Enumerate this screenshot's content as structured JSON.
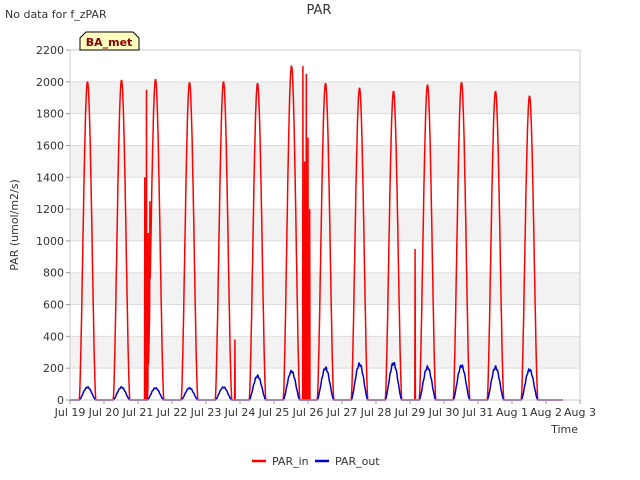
{
  "corner_note": "No data for f_zPAR",
  "chart_data": {
    "type": "line",
    "title": "PAR",
    "xlabel": "Time",
    "ylabel": "PAR (umol/m2/s)",
    "station_badge": "BA_met",
    "ylim": [
      0,
      2200
    ],
    "yticks": [
      0,
      200,
      400,
      600,
      800,
      1000,
      1200,
      1400,
      1600,
      1800,
      2000,
      2200
    ],
    "xticks": [
      "Jul 19",
      "Jul 20",
      "Jul 21",
      "Jul 22",
      "Jul 23",
      "Jul 24",
      "Jul 25",
      "Jul 26",
      "Jul 27",
      "Jul 28",
      "Jul 29",
      "Jul 30",
      "Jul 31",
      "Aug 1",
      "Aug 2",
      "Aug 3"
    ],
    "x_range_days": [
      0,
      15
    ],
    "grid": "horizontal banded",
    "legend_position": "bottom-center",
    "series": [
      {
        "name": "PAR_in",
        "color": "#ff0000",
        "daily_peaks": [
          2000,
          2010,
          2015,
          1995,
          2000,
          1990,
          2100,
          1990,
          1960,
          1940,
          1980,
          1995,
          1940,
          1910
        ],
        "spikes": [
          {
            "day": 2.2,
            "value": 1400
          },
          {
            "day": 2.25,
            "value": 1950
          },
          {
            "day": 2.3,
            "value": 1050
          },
          {
            "day": 2.35,
            "value": 1250
          },
          {
            "day": 6.85,
            "value": 2100
          },
          {
            "day": 6.9,
            "value": 1500
          },
          {
            "day": 6.95,
            "value": 2050
          },
          {
            "day": 7.0,
            "value": 1650
          },
          {
            "day": 7.05,
            "value": 1200
          },
          {
            "day": 4.85,
            "value": 380
          },
          {
            "day": 10.15,
            "value": 950
          }
        ]
      },
      {
        "name": "PAR_out",
        "color": "#0000cc",
        "daily_peaks": [
          80,
          80,
          75,
          75,
          80,
          150,
          180,
          200,
          225,
          230,
          205,
          215,
          205,
          190
        ]
      }
    ]
  }
}
